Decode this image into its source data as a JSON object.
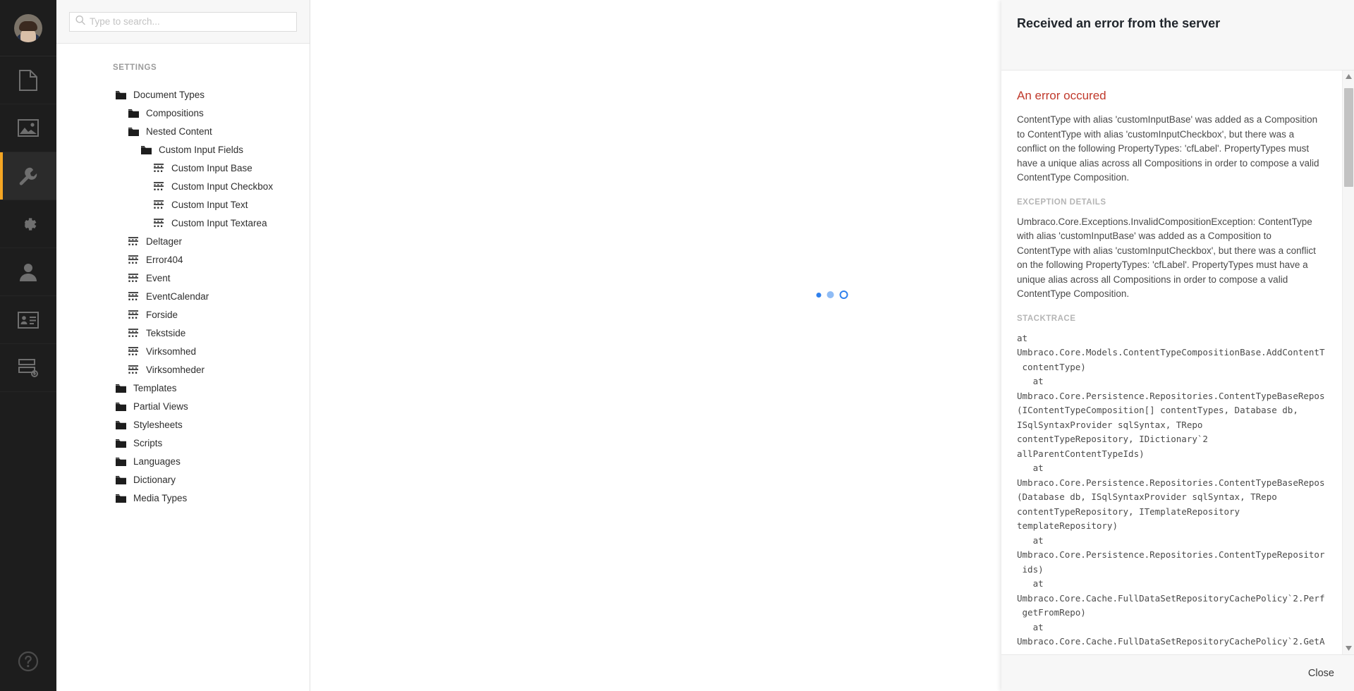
{
  "app": {
    "accent_orange": "#f5a623",
    "error_red": "#c0392b",
    "spinner_blue": "#2f80ed"
  },
  "rail": {
    "avatar_name": "user-avatar",
    "items": [
      {
        "icon": "document-icon",
        "label": "Content",
        "active": false
      },
      {
        "icon": "image-icon",
        "label": "Media",
        "active": false
      },
      {
        "icon": "wrench-icon",
        "label": "Settings",
        "active": true
      },
      {
        "icon": "gear-icon",
        "label": "Developer",
        "active": false
      },
      {
        "icon": "user-icon",
        "label": "Users",
        "active": false
      },
      {
        "icon": "id-card-icon",
        "label": "Members",
        "active": false
      },
      {
        "icon": "forms-icon",
        "label": "Forms",
        "active": false
      }
    ],
    "help_label": "Help"
  },
  "search": {
    "placeholder": "Type to search...",
    "value": "",
    "icon": "search-icon"
  },
  "sidebar": {
    "section_title": "SETTINGS",
    "tree": [
      {
        "label": "Document Types",
        "icon": "folder-icon",
        "depth": 0
      },
      {
        "label": "Compositions",
        "icon": "folder-icon",
        "depth": 1
      },
      {
        "label": "Nested Content",
        "icon": "folder-icon",
        "depth": 1
      },
      {
        "label": "Custom Input Fields",
        "icon": "folder-icon",
        "depth": 2
      },
      {
        "label": "Custom Input Base",
        "icon": "doctype-icon",
        "depth": 3
      },
      {
        "label": "Custom Input Checkbox",
        "icon": "doctype-icon",
        "depth": 3
      },
      {
        "label": "Custom Input Text",
        "icon": "doctype-icon",
        "depth": 3
      },
      {
        "label": "Custom Input Textarea",
        "icon": "doctype-icon",
        "depth": 3
      },
      {
        "label": "Deltager",
        "icon": "doctype-icon",
        "depth": 1
      },
      {
        "label": "Error404",
        "icon": "doctype-icon",
        "depth": 1
      },
      {
        "label": "Event",
        "icon": "doctype-icon",
        "depth": 1
      },
      {
        "label": "EventCalendar",
        "icon": "doctype-icon",
        "depth": 1
      },
      {
        "label": "Forside",
        "icon": "doctype-icon",
        "depth": 1
      },
      {
        "label": "Tekstside",
        "icon": "doctype-icon",
        "depth": 1
      },
      {
        "label": "Virksomhed",
        "icon": "doctype-icon",
        "depth": 1
      },
      {
        "label": "Virksomheder",
        "icon": "doctype-icon",
        "depth": 1
      },
      {
        "label": "Templates",
        "icon": "folder-icon",
        "depth": 0
      },
      {
        "label": "Partial Views",
        "icon": "folder-icon",
        "depth": 0
      },
      {
        "label": "Stylesheets",
        "icon": "folder-icon",
        "depth": 0
      },
      {
        "label": "Scripts",
        "icon": "folder-icon",
        "depth": 0
      },
      {
        "label": "Languages",
        "icon": "folder-icon",
        "depth": 0
      },
      {
        "label": "Dictionary",
        "icon": "folder-icon",
        "depth": 0
      },
      {
        "label": "Media Types",
        "icon": "folder-icon",
        "depth": 0
      }
    ]
  },
  "main": {
    "loading_indicator": "three-dot-loader"
  },
  "overlay": {
    "title": "Received an error from the server",
    "error_heading": "An error occured",
    "error_message": "ContentType with alias 'customInputBase' was added as a Composition to ContentType with alias 'customInputCheckbox', but there was a conflict on the following PropertyTypes: 'cfLabel'. PropertyTypes must have a unique alias across all Compositions in order to compose a valid ContentType Composition.",
    "exception_details_label": "EXCEPTION DETAILS",
    "exception_details": "Umbraco.Core.Exceptions.InvalidCompositionException: ContentType with alias 'customInputBase' was added as a Composition to ContentType with alias 'customInputCheckbox', but there was a conflict on the following PropertyTypes: 'cfLabel'. PropertyTypes must have a unique alias across all Compositions in order to compose a valid ContentType Composition.",
    "stacktrace_label": "STACKTRACE",
    "stacktrace": "at\nUmbraco.Core.Models.ContentTypeCompositionBase.AddContentT\n contentType)\n   at\nUmbraco.Core.Persistence.Repositories.ContentTypeBaseRepos\n(IContentTypeComposition[] contentTypes, Database db,\nISqlSyntaxProvider sqlSyntax, TRepo\ncontentTypeRepository, IDictionary`2\nallParentContentTypeIds)\n   at\nUmbraco.Core.Persistence.Repositories.ContentTypeBaseRepos\n(Database db, ISqlSyntaxProvider sqlSyntax, TRepo\ncontentTypeRepository, ITemplateRepository\ntemplateRepository)\n   at\nUmbraco.Core.Persistence.Repositories.ContentTypeRepositor\n ids)\n   at\nUmbraco.Core.Cache.FullDataSetRepositoryCachePolicy`2.Perf\n getFromRepo)\n   at\nUmbraco.Core.Cache.FullDataSetRepositoryCachePolicy`2.GetA",
    "close_label": "Close",
    "scrollbar": {
      "up_arrow": "scroll-up-arrow-icon",
      "down_arrow": "scroll-down-arrow-icon"
    }
  }
}
